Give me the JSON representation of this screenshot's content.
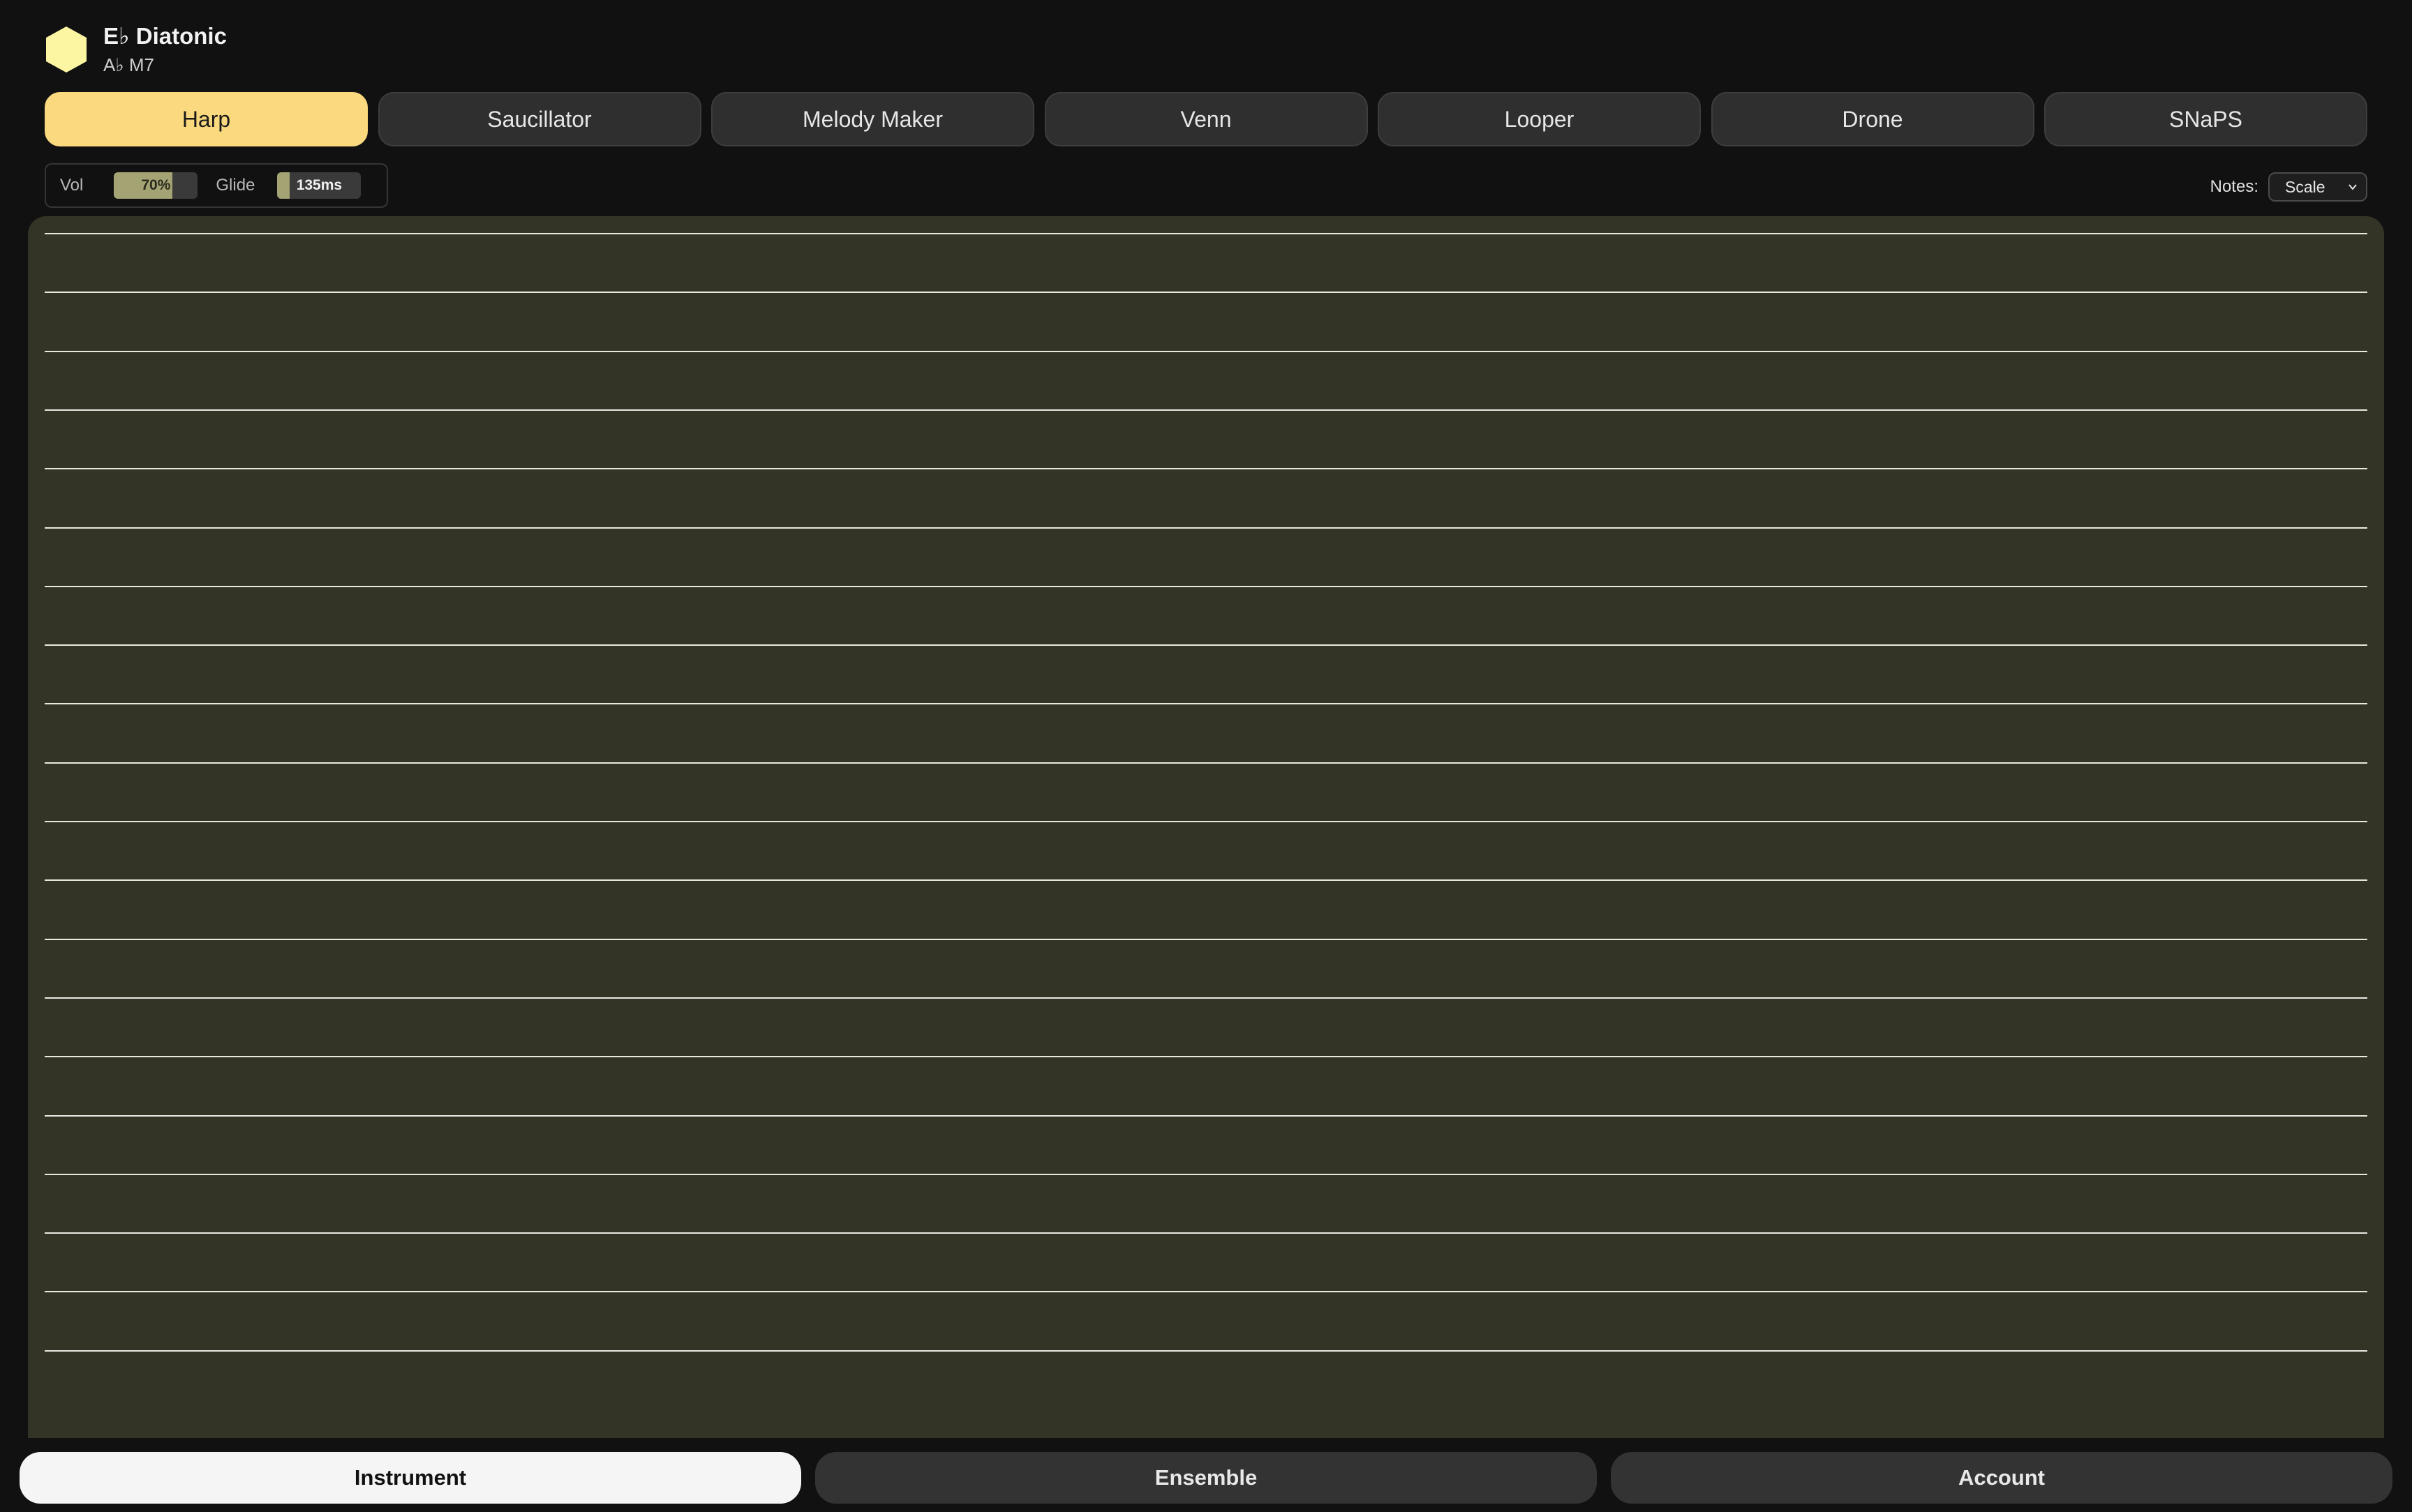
{
  "header": {
    "key_title": "E♭ Diatonic",
    "chord_subtitle": "A♭ M7",
    "logo_icon": "hexagon-icon",
    "logo_color": "#fcf6a2"
  },
  "tabs": [
    {
      "label": "Harp",
      "active": true
    },
    {
      "label": "Saucillator",
      "active": false
    },
    {
      "label": "Melody Maker",
      "active": false
    },
    {
      "label": "Venn",
      "active": false
    },
    {
      "label": "Looper",
      "active": false
    },
    {
      "label": "Drone",
      "active": false
    },
    {
      "label": "SNaPS",
      "active": false
    }
  ],
  "controls": {
    "vol_label": "Vol",
    "vol_value": "70%",
    "vol_level_percent": 70,
    "glide_label": "Glide",
    "glide_value": "135ms",
    "glide_level_percent": 15
  },
  "notes": {
    "label": "Notes:",
    "selected": "Scale"
  },
  "harp": {
    "string_count": 20,
    "background_color": "#333425",
    "string_color": "#e9e9e2"
  },
  "bottom_nav": [
    {
      "label": "Instrument",
      "active": true
    },
    {
      "label": "Ensemble",
      "active": false
    },
    {
      "label": "Account",
      "active": false
    }
  ],
  "colors": {
    "accent": "#fbd97e",
    "background": "#111111"
  }
}
